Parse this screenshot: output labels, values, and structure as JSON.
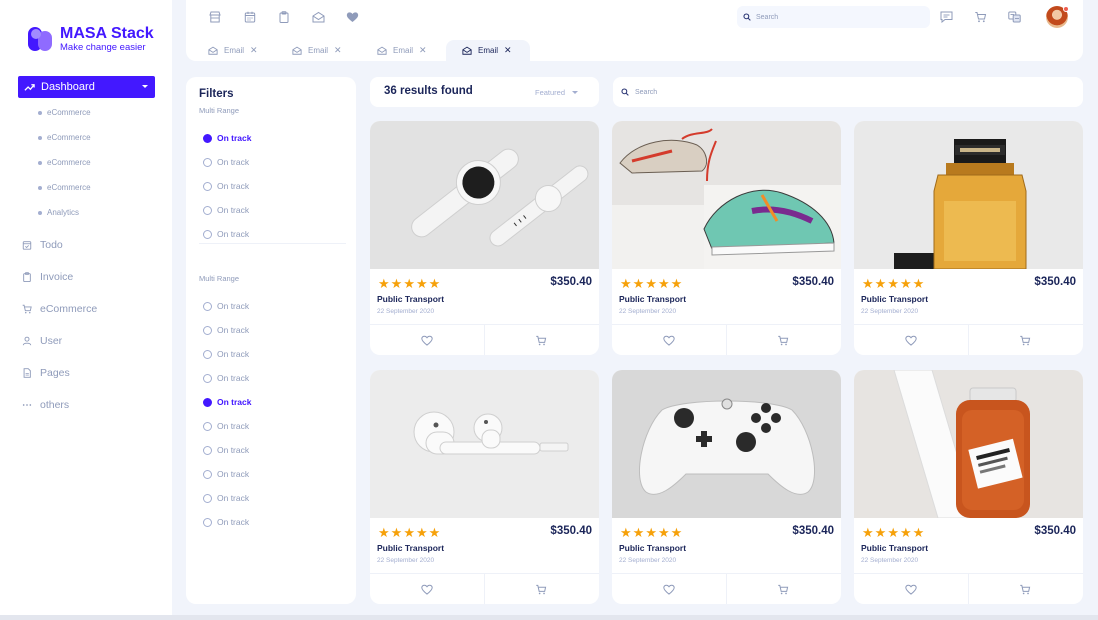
{
  "brand": {
    "name": "MASA Stack",
    "tagline": "Make change easier"
  },
  "sidebar": {
    "active": {
      "label": "Dashboard",
      "icon": "trending-up-icon"
    },
    "sub_items": [
      "eCommerce",
      "eCommerce",
      "eCommerce",
      "eCommerce",
      "Analytics"
    ],
    "items": [
      {
        "label": "Todo",
        "icon": "calendar-check-icon"
      },
      {
        "label": "Invoice",
        "icon": "clipboard-icon"
      },
      {
        "label": "eCommerce",
        "icon": "cart-icon"
      },
      {
        "label": "User",
        "icon": "user-icon"
      },
      {
        "label": "Pages",
        "icon": "page-icon"
      },
      {
        "label": "others",
        "icon": "ellipsis-icon"
      }
    ]
  },
  "topbar": {
    "quick_icons": [
      "storefront-icon",
      "calendar-icon",
      "clipboard-icon",
      "mail-icon",
      "heart-icon"
    ],
    "search_placeholder": "Search",
    "right_icons": [
      "chat-icon",
      "cart-icon",
      "translate-icon"
    ],
    "tabs": [
      {
        "label": "Email",
        "active": false
      },
      {
        "label": "Email",
        "active": false
      },
      {
        "label": "Email",
        "active": false
      },
      {
        "label": "Email",
        "active": true
      }
    ]
  },
  "filters": {
    "title": "Filters",
    "groups": [
      {
        "label": "Multi Range",
        "options": [
          "On track",
          "On track",
          "On track",
          "On track",
          "On track"
        ],
        "selected": 0
      },
      {
        "label": "Multi Range",
        "options": [
          "On track",
          "On track",
          "On track",
          "On track",
          "On track",
          "On track",
          "On track",
          "On track",
          "On track",
          "On track"
        ],
        "selected": 4
      }
    ]
  },
  "results": {
    "count_label": "36 results found",
    "sort_label": "Featured",
    "search_placeholder": "Search"
  },
  "products": [
    {
      "title": "Public Transport",
      "date": "22 September 2020",
      "price": "$350.40",
      "rating": 5,
      "image": "smartwatch"
    },
    {
      "title": "Public Transport",
      "date": "22 September 2020",
      "price": "$350.40",
      "rating": 5,
      "image": "sneakers"
    },
    {
      "title": "Public Transport",
      "date": "22 September 2020",
      "price": "$350.40",
      "rating": 5,
      "image": "perfume-bottle"
    },
    {
      "title": "Public Transport",
      "date": "22 September 2020",
      "price": "$350.40",
      "rating": 5,
      "image": "earbuds"
    },
    {
      "title": "Public Transport",
      "date": "22 September 2020",
      "price": "$350.40",
      "rating": 5,
      "image": "game-controller"
    },
    {
      "title": "Public Transport",
      "date": "22 September 2020",
      "price": "$350.40",
      "rating": 5,
      "image": "body-oil-bottle"
    }
  ],
  "colors": {
    "accent": "#4318ff",
    "star": "#f6a10a",
    "text": "#1b2559",
    "muted": "#8f9bba",
    "background": "#f1f4fb"
  }
}
